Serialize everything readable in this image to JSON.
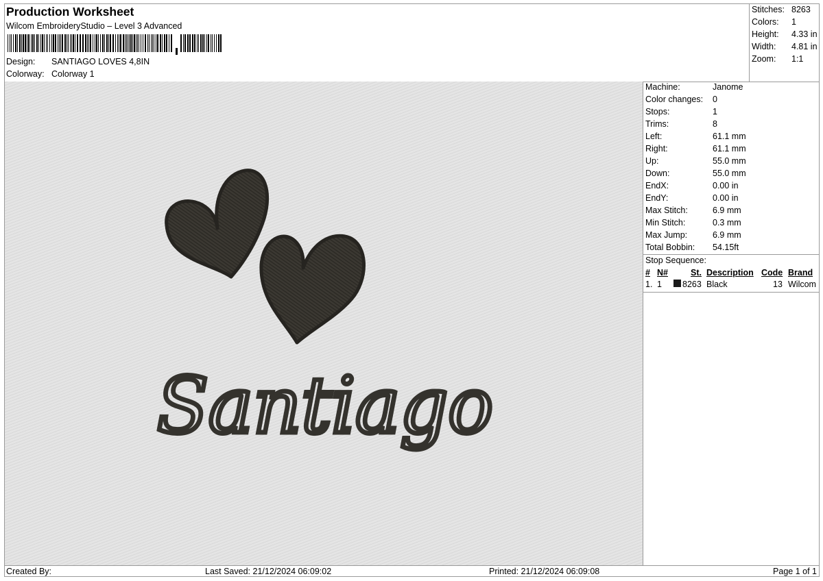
{
  "header": {
    "title": "Production Worksheet",
    "subtitle": "Wilcom EmbroideryStudio – Level 3 Advanced",
    "design_label": "Design:",
    "design_value": "SANTIAGO LOVES 4,8IN",
    "colorway_label": "Colorway:",
    "colorway_value": "Colorway 1"
  },
  "stats": [
    {
      "label": "Stitches:",
      "value": "8263"
    },
    {
      "label": "Colors:",
      "value": "1"
    },
    {
      "label": "Height:",
      "value": "4.33 in"
    },
    {
      "label": "Width:",
      "value": "4.81 in"
    },
    {
      "label": "Zoom:",
      "value": "1:1"
    }
  ],
  "properties": [
    {
      "label": "Machine:",
      "value": "Janome"
    },
    {
      "label": "Color changes:",
      "value": "0"
    },
    {
      "label": "Stops:",
      "value": "1"
    },
    {
      "label": "Trims:",
      "value": "8"
    },
    {
      "label": "Left:",
      "value": "61.1 mm"
    },
    {
      "label": "Right:",
      "value": "61.1 mm"
    },
    {
      "label": "Up:",
      "value": "55.0 mm"
    },
    {
      "label": "Down:",
      "value": "55.0 mm"
    },
    {
      "label": "EndX:",
      "value": "0.00 in"
    },
    {
      "label": "EndY:",
      "value": "0.00 in"
    },
    {
      "label": "Max Stitch:",
      "value": "6.9 mm"
    },
    {
      "label": "Min Stitch:",
      "value": "0.3 mm"
    },
    {
      "label": "Max Jump:",
      "value": "6.9 mm"
    },
    {
      "label": "Total Bobbin:",
      "value": "54.15ft"
    }
  ],
  "stop_sequence": {
    "label": "Stop Sequence:",
    "headers": {
      "num": "#",
      "n": "N#",
      "st": "St.",
      "desc": "Description",
      "code": "Code",
      "brand": "Brand"
    },
    "rows": [
      {
        "num": "1.",
        "n": "1",
        "color": "#1a1a1a",
        "st": "8263",
        "desc": "Black",
        "code": "13",
        "brand": "Wilcom"
      }
    ]
  },
  "preview": {
    "text": "Santiago",
    "thread_color": "#3b3832",
    "fabric_color": "#e2e2e2"
  },
  "footer": {
    "created_by": "Created By:",
    "last_saved": "Last Saved: 21/12/2024 06:09:02",
    "printed": "Printed: 21/12/2024 06:09:08",
    "page": "Page 1 of 1"
  }
}
